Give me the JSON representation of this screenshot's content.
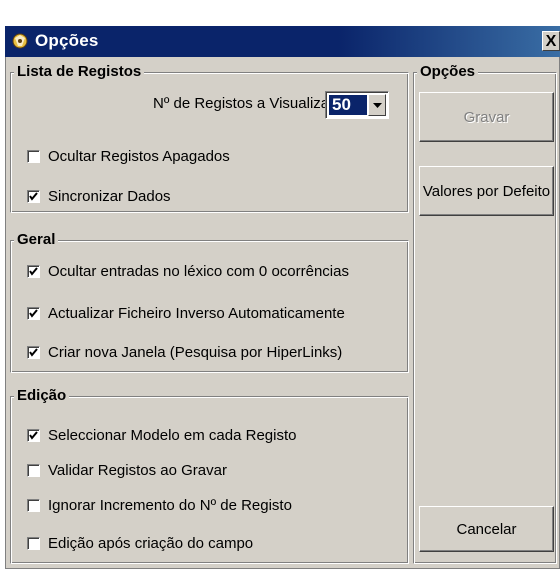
{
  "window": {
    "title": "Opções",
    "close_label": "X"
  },
  "lista": {
    "legend": "Lista de Registos",
    "regs_label": "Nº de Registos a Visualizar",
    "regs_value": "50",
    "checkboxes": [
      {
        "label": "Ocultar Registos Apagados",
        "checked": false
      },
      {
        "label": "Sincronizar Dados",
        "checked": true
      }
    ]
  },
  "geral": {
    "legend": "Geral",
    "checkboxes": [
      {
        "label": "Ocultar entradas no léxico com 0 ocorrências",
        "checked": true
      },
      {
        "label": "Actualizar Ficheiro Inverso Automaticamente",
        "checked": true
      },
      {
        "label": "Criar nova Janela (Pesquisa por HiperLinks)",
        "checked": true
      }
    ]
  },
  "edicao": {
    "legend": "Edição",
    "checkboxes": [
      {
        "label": "Seleccionar Modelo em cada Registo",
        "checked": true
      },
      {
        "label": "Validar Registos ao Gravar",
        "checked": false
      },
      {
        "label": "Ignorar Incremento do Nº de Registo",
        "checked": false
      },
      {
        "label": "Edição após criação do campo",
        "checked": false
      }
    ]
  },
  "opcoes": {
    "legend": "Opções",
    "gravar_label": "Gravar",
    "valores_label": "Valores por Defeito",
    "cancelar_label": "Cancelar"
  }
}
